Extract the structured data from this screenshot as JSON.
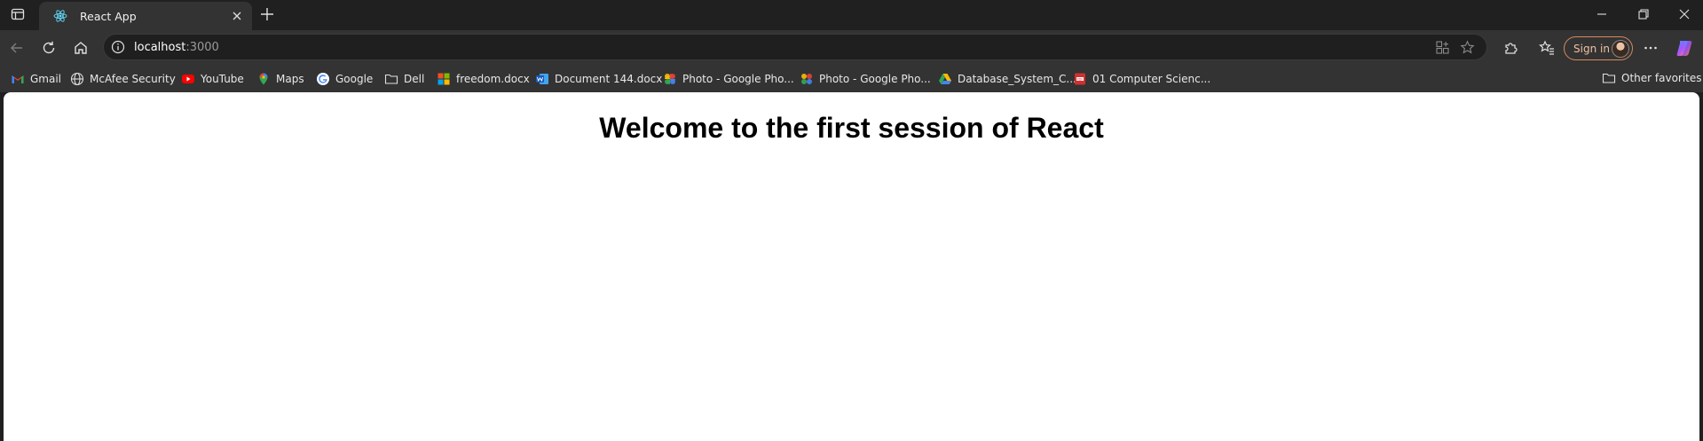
{
  "tab": {
    "title": "React App"
  },
  "omnibox": {
    "host": "localhost",
    "port": ":3000"
  },
  "toolbar": {
    "signin_label": "Sign in"
  },
  "favorites": [
    {
      "label": "Gmail",
      "icon": "gmail-icon"
    },
    {
      "label": "McAfee Security",
      "icon": "globe-icon"
    },
    {
      "label": "YouTube",
      "icon": "youtube-icon"
    },
    {
      "label": "Maps",
      "icon": "maps-icon"
    },
    {
      "label": "Google",
      "icon": "google-icon"
    },
    {
      "label": "Dell",
      "icon": "folder-icon"
    },
    {
      "label": "freedom.docx",
      "icon": "microsoft-icon"
    },
    {
      "label": "Document 144.docx",
      "icon": "word-icon"
    },
    {
      "label": "Photo - Google Pho...",
      "icon": "google-photos-icon"
    },
    {
      "label": "Photo - Google Pho...",
      "icon": "google-photos-icon"
    },
    {
      "label": "Database_System_C...",
      "icon": "google-drive-icon"
    },
    {
      "label": "01 Computer Scienc...",
      "icon": "pdf-icon"
    }
  ],
  "other_favorites": "Other favorites",
  "page": {
    "heading": "Welcome to the first session of React"
  },
  "colors": {
    "chrome_dark": "#202020",
    "toolbar": "#333333",
    "signin_accent": "#d9895a"
  }
}
